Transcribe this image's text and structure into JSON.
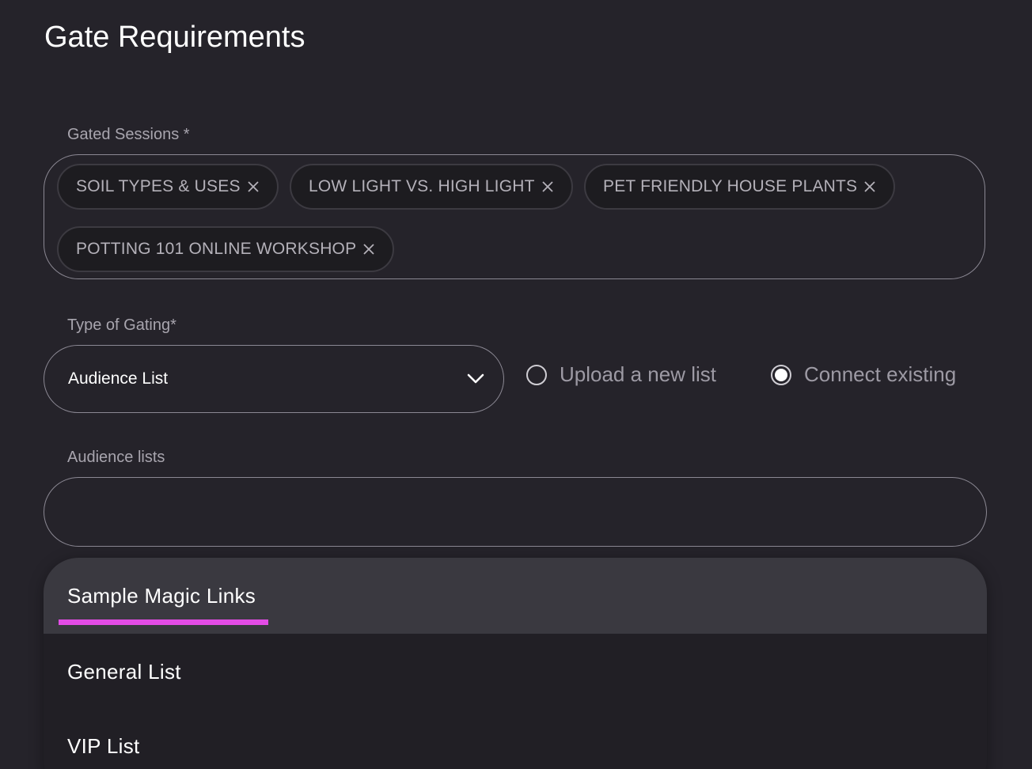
{
  "page": {
    "title": "Gate Requirements"
  },
  "gated_sessions": {
    "label": "Gated Sessions *",
    "chips": [
      {
        "label": "SOIL TYPES & USES"
      },
      {
        "label": "LOW LIGHT VS. HIGH LIGHT"
      },
      {
        "label": "PET FRIENDLY HOUSE PLANTS"
      },
      {
        "label": "POTTING 101 ONLINE WORKSHOP"
      }
    ]
  },
  "gating_type": {
    "label": "Type of Gating*",
    "selected": "Audience List",
    "radios": [
      {
        "label": "Upload a new list",
        "checked": false
      },
      {
        "label": "Connect existing",
        "checked": true
      }
    ]
  },
  "audience_lists": {
    "label": "Audience lists",
    "value": "",
    "options": [
      {
        "label": "Sample Magic Links",
        "highlighted": true
      },
      {
        "label": "General List",
        "highlighted": false
      },
      {
        "label": "VIP List",
        "highlighted": false
      }
    ]
  },
  "colors": {
    "background": "#25232a",
    "accent_underline": "#e34ce6",
    "highlight_row": "#3a3940"
  },
  "icons": {
    "chip_remove": "close-icon",
    "select_arrow": "chevron-down-icon"
  }
}
